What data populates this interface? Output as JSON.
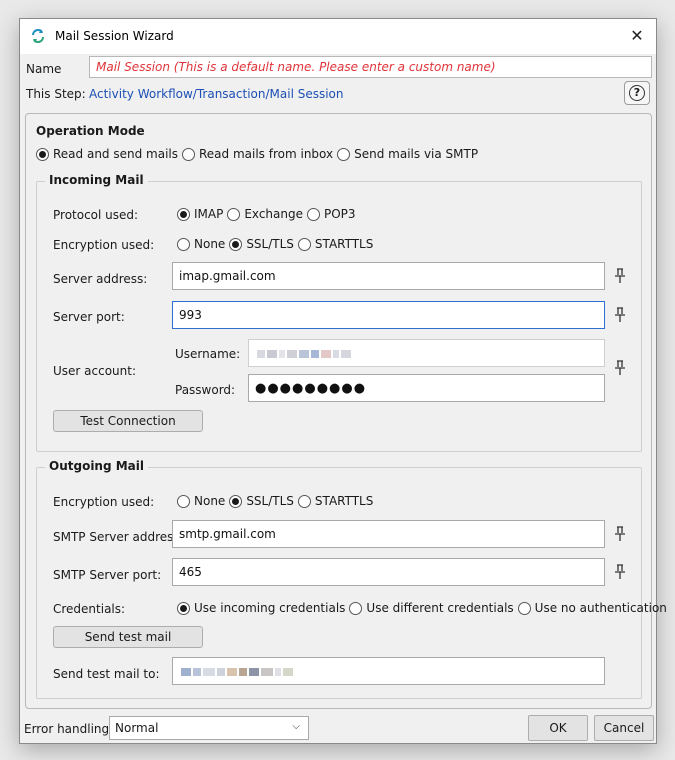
{
  "window": {
    "title": "Mail Session Wizard"
  },
  "header": {
    "name_label": "Name",
    "name_value": "Mail Session  (This is a default name. Please enter a custom name)",
    "step_label": "This Step:",
    "step_value": "Activity Workflow/Transaction/Mail Session"
  },
  "operation": {
    "title": "Operation Mode",
    "options": [
      "Read and send mails",
      "Read mails from inbox",
      "Send mails via SMTP"
    ],
    "selected": "Read and send mails"
  },
  "incoming": {
    "legend": "Incoming Mail",
    "protocol_label": "Protocol used:",
    "protocol_options": [
      "IMAP",
      "Exchange",
      "POP3"
    ],
    "protocol_selected": "IMAP",
    "encryption_label": "Encryption used:",
    "encryption_options": [
      "None",
      "SSL/TLS",
      "STARTTLS"
    ],
    "encryption_selected": "SSL/TLS",
    "server_address_label": "Server address:",
    "server_address": "imap.gmail.com",
    "server_port_label": "Server port:",
    "server_port": "993",
    "user_account_label": "User account:",
    "username_label": "Username:",
    "password_label": "Password:",
    "password_mask": "●●●●●●●●●",
    "test_button": "Test Connection"
  },
  "outgoing": {
    "legend": "Outgoing Mail",
    "encryption_label": "Encryption used:",
    "encryption_options": [
      "None",
      "SSL/TLS",
      "STARTTLS"
    ],
    "encryption_selected": "SSL/TLS",
    "smtp_address_label": "SMTP Server address",
    "smtp_address": "smtp.gmail.com",
    "smtp_port_label": "SMTP Server port:",
    "smtp_port": "465",
    "credentials_label": "Credentials:",
    "credentials_options": [
      "Use incoming credentials",
      "Use different credentials",
      "Use no authentication"
    ],
    "credentials_selected": "Use incoming credentials",
    "send_test_button": "Send test mail",
    "send_to_label": "Send test mail to:"
  },
  "footer": {
    "error_label": "Error handling:",
    "error_value": "Normal",
    "ok": "OK",
    "cancel": "Cancel"
  },
  "colors": {
    "accent": "#2f6fd1",
    "link": "#1c4fb5",
    "warning_text": "#e0343a"
  }
}
